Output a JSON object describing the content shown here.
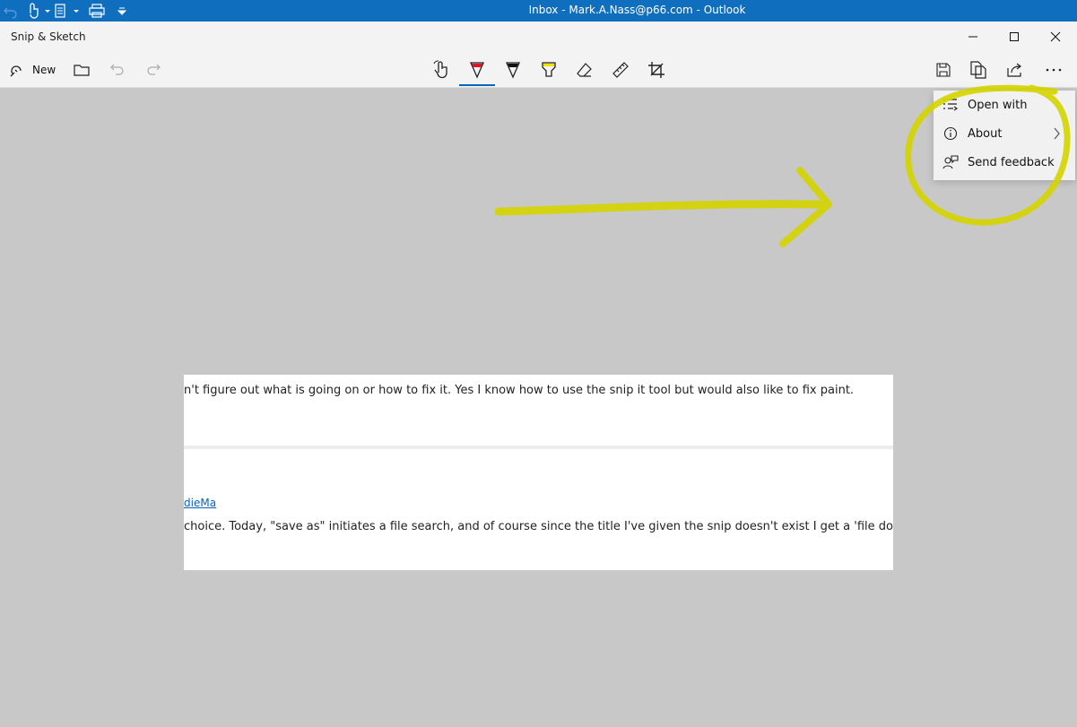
{
  "outlook": {
    "title": "Inbox - Mark.A.Nass@p66.com  -  Outlook"
  },
  "app": {
    "title": "Snip & Sketch"
  },
  "toolbar": {
    "new_label": "New",
    "tools": [
      {
        "name": "touch-writing"
      },
      {
        "name": "ballpoint-pen",
        "active": true
      },
      {
        "name": "pencil"
      },
      {
        "name": "highlighter"
      },
      {
        "name": "eraser"
      },
      {
        "name": "ruler"
      },
      {
        "name": "image-crop"
      }
    ],
    "accent": "#0067c0"
  },
  "menu": {
    "items": [
      {
        "label": "Open with",
        "icon": "open-with-icon"
      },
      {
        "label": "About",
        "icon": "info-icon"
      },
      {
        "label": "Send feedback",
        "icon": "feedback-icon"
      }
    ]
  },
  "snip": {
    "line1": "n't figure out what is going on or how to fix it. Yes I know how to use the snip it tool but would also like to fix paint.",
    "link": "dieMa",
    "line2": "choice. Today, \"save as\" initiates a file search, and of course since the title I've given the snip doesn't exist I get a 'file doe"
  },
  "colors": {
    "outlook_bar": "#106ebe",
    "canvas_bg": "#c8c8c8",
    "annotation": "#d4d400"
  }
}
